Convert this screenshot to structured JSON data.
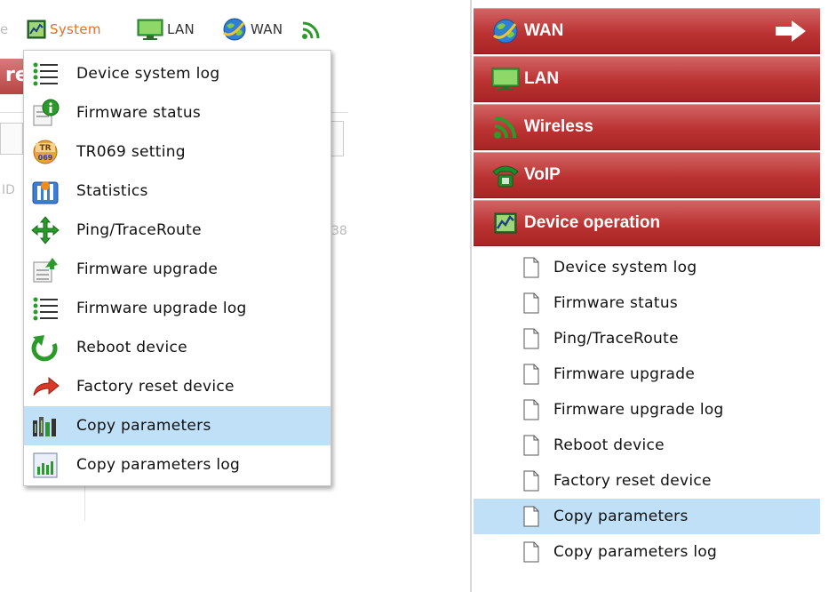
{
  "top_menu": {
    "fragment": "e",
    "items": [
      {
        "label": "System",
        "icon": "system-chart-icon"
      },
      {
        "label": "LAN",
        "icon": "monitor-icon"
      },
      {
        "label": "WAN",
        "icon": "globe-icon"
      },
      {
        "label": "",
        "icon": "wireless-icon"
      }
    ],
    "active_color": "#ee6e14"
  },
  "dropdown": {
    "items": [
      {
        "label": "Device system log",
        "icon": "list-icon"
      },
      {
        "label": "Firmware status",
        "icon": "info-icon"
      },
      {
        "label": "TR069 setting",
        "icon": "tr069-icon"
      },
      {
        "label": "Statistics",
        "icon": "statistics-icon"
      },
      {
        "label": "Ping/TraceRoute",
        "icon": "move-arrows-icon"
      },
      {
        "label": "Firmware upgrade",
        "icon": "upgrade-icon"
      },
      {
        "label": "Firmware upgrade log",
        "icon": "list-icon"
      },
      {
        "label": "Reboot device",
        "icon": "reboot-icon"
      },
      {
        "label": "Factory reset device",
        "icon": "reset-arrow-icon"
      },
      {
        "label": "Copy parameters",
        "icon": "copy-parameters-icon",
        "selected": true
      },
      {
        "label": "Copy parameters log",
        "icon": "copy-log-icon"
      }
    ],
    "selected_color": "#bfe0f7"
  },
  "background": {
    "fragment_re": "re",
    "fragment_id": "ID",
    "fragment_num": "38"
  },
  "side_menu": {
    "sections": [
      {
        "label": "WAN",
        "icon": "globe-icon"
      },
      {
        "label": "LAN",
        "icon": "monitor-icon"
      },
      {
        "label": "Wireless",
        "icon": "wireless-icon"
      },
      {
        "label": "VoIP",
        "icon": "phone-icon"
      },
      {
        "label": "Device operation",
        "icon": "system-chart-icon"
      }
    ],
    "header_color": "#bb3232",
    "subitems": [
      {
        "label": "Device system log"
      },
      {
        "label": "Firmware status"
      },
      {
        "label": "Ping/TraceRoute"
      },
      {
        "label": "Firmware upgrade"
      },
      {
        "label": "Firmware upgrade log"
      },
      {
        "label": "Reboot device"
      },
      {
        "label": "Factory reset device"
      },
      {
        "label": "Copy parameters",
        "selected": true
      },
      {
        "label": "Copy parameters log"
      }
    ]
  }
}
